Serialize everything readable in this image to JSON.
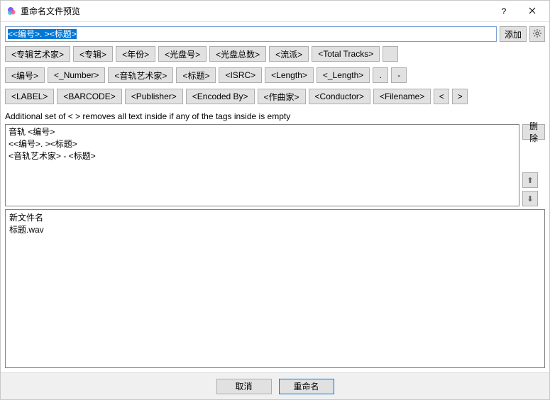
{
  "window": {
    "title": "重命名文件预览",
    "help": "?",
    "close": "×"
  },
  "pattern": {
    "value": "<<编号>. ><标题>",
    "add_label": "添加"
  },
  "tag_rows": [
    [
      "<专辑艺术家>",
      "<专辑>",
      "<年份>",
      "<光盘号>",
      "<光盘总数>",
      "<流派>",
      "<Total Tracks>"
    ],
    [
      "<编号>",
      "<_Number>",
      "<音轨艺术家>",
      "<标题>",
      "<ISRC>",
      "<Length>",
      "<_Length>",
      ".",
      "-"
    ],
    [
      "<LABEL>",
      "<BARCODE>",
      "<Publisher>",
      "<Encoded By>",
      "<作曲家>",
      "<Conductor>",
      "<Filename>",
      "<",
      ">"
    ]
  ],
  "extra_button": "",
  "note": "Additional set of < > removes all text inside if any of the tags inside is empty",
  "templates": [
    "音轨 <编号>",
    "<<编号>. ><标题>",
    "<音轨艺术家> - <标题>"
  ],
  "side": {
    "delete_label": "删除",
    "up": "⬆",
    "down": "⬇"
  },
  "preview": {
    "header": "新文件名",
    "rows": [
      "标题.wav"
    ]
  },
  "footer": {
    "cancel": "取消",
    "rename": "重命名"
  }
}
